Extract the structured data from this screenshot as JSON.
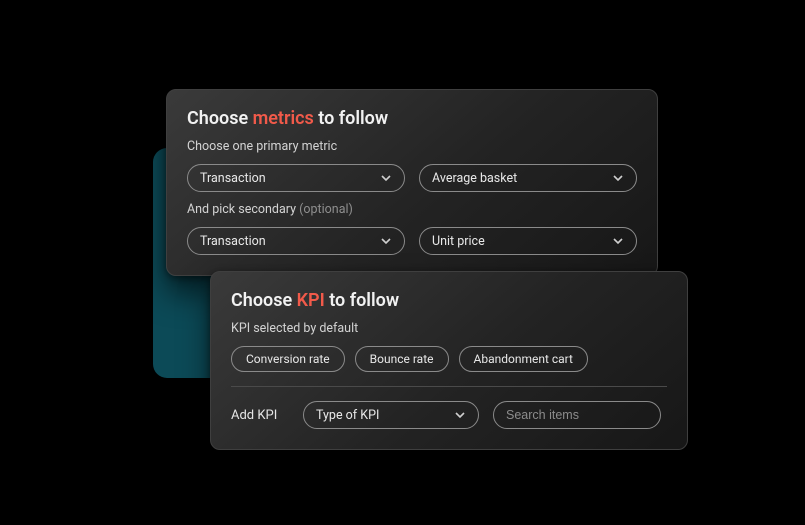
{
  "colors": {
    "accent": "#f15a4a",
    "teal": "#0c4a57"
  },
  "metrics_panel": {
    "title_prefix": "Choose ",
    "title_accent": "metrics",
    "title_suffix": " to follow",
    "primary_label": "Choose one primary metric",
    "secondary_label": "And pick secondary ",
    "secondary_optional": "(optional)",
    "primary_select_1": "Transaction",
    "primary_select_2": "Average basket",
    "secondary_select_1": "Transaction",
    "secondary_select_2": "Unit price"
  },
  "kpi_panel": {
    "title_prefix": "Choose ",
    "title_accent": "KPI",
    "title_suffix": " to follow",
    "default_label": "KPI selected by default",
    "chips": [
      "Conversion rate",
      "Bounce rate",
      "Abandonment cart"
    ],
    "add_label": "Add KPI",
    "type_select": "Type of KPI",
    "search_placeholder": "Search items"
  }
}
